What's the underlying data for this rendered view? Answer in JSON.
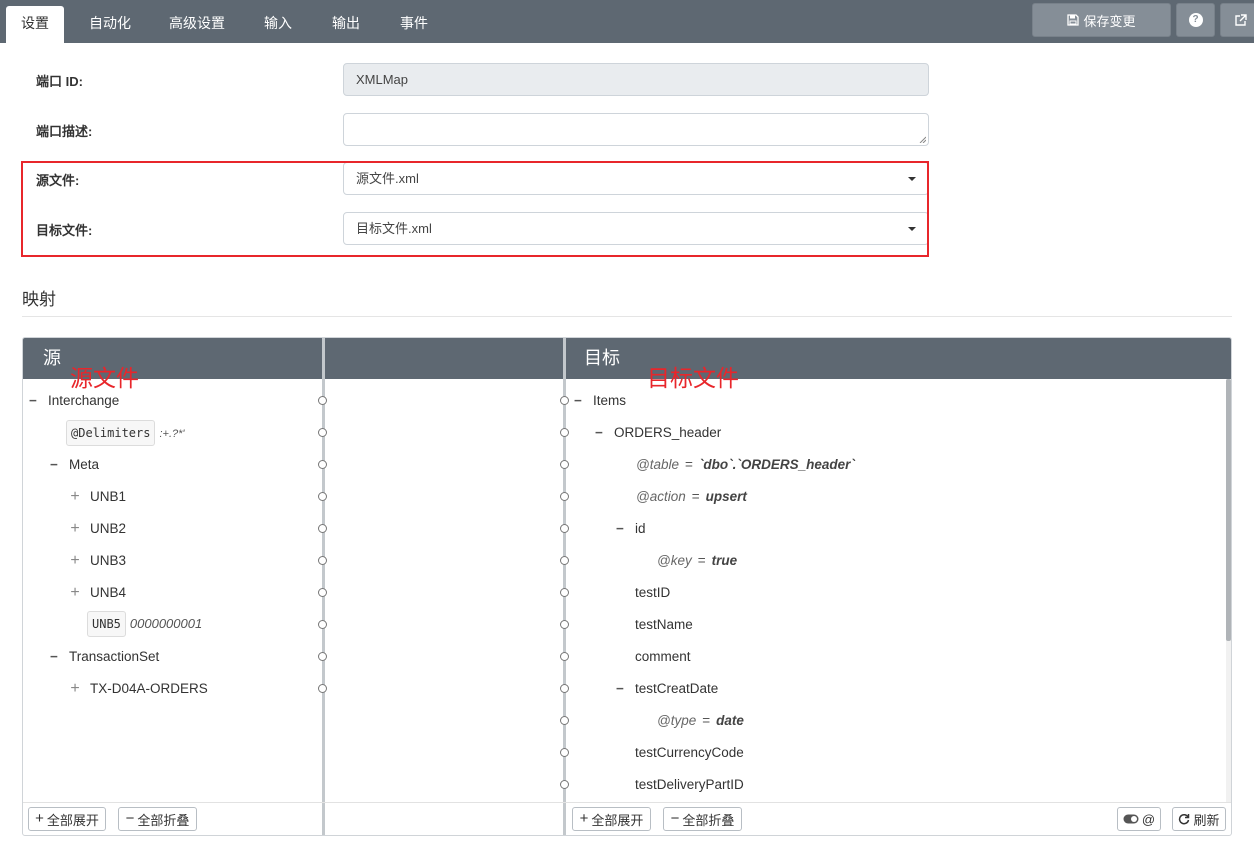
{
  "tabs": [
    {
      "label": "设置",
      "active": true
    },
    {
      "label": "自动化"
    },
    {
      "label": "高级设置"
    },
    {
      "label": "输入"
    },
    {
      "label": "输出"
    },
    {
      "label": "事件"
    }
  ],
  "toolbar": {
    "save_label": "保存变更",
    "help_label": "?"
  },
  "form": {
    "port_id_label": "端口 ID:",
    "port_id_value": "XMLMap",
    "port_desc_label": "端口描述:",
    "port_desc_value": "",
    "source_label": "源文件:",
    "source_value": "源文件.xml",
    "target_label": "目标文件:",
    "target_value": "目标文件.xml"
  },
  "mapping": {
    "section_title": "映射",
    "source_header": "源",
    "target_header": "目标",
    "source_annotation": "源文件",
    "target_annotation": "目标文件",
    "source_tree": {
      "interchange": "Interchange",
      "delimiters_name": "@Delimiters",
      "delimiters_value": ":+.?*'",
      "meta": "Meta",
      "unb1": "UNB1",
      "unb2": "UNB2",
      "unb3": "UNB3",
      "unb4": "UNB4",
      "unb5_name": "UNB5",
      "unb5_value": "0000000001",
      "transaction_set": "TransactionSet",
      "tx_orders": "TX-D04A-ORDERS"
    },
    "target_tree": {
      "items": "Items",
      "orders_header": "ORDERS_header",
      "table_attr": "@table",
      "table_value": "`dbo`.`ORDERS_header`",
      "action_attr": "@action",
      "action_value": "upsert",
      "id": "id",
      "key_attr": "@key",
      "key_value": "true",
      "test_id": "testID",
      "test_name": "testName",
      "comment": "comment",
      "test_creat_date": "testCreatDate",
      "type_attr": "@type",
      "type_value": "date",
      "test_currency_code": "testCurrencyCode",
      "test_delivery_part_id": "testDeliveryPartID",
      "equals": "="
    },
    "buttons": {
      "expand_all": "全部展开",
      "collapse_all": "全部折叠",
      "attr_toggle": "@",
      "refresh": "刷新"
    }
  },
  "colors": {
    "header_bg": "#5e6872",
    "highlight_red": "#e8262b"
  }
}
